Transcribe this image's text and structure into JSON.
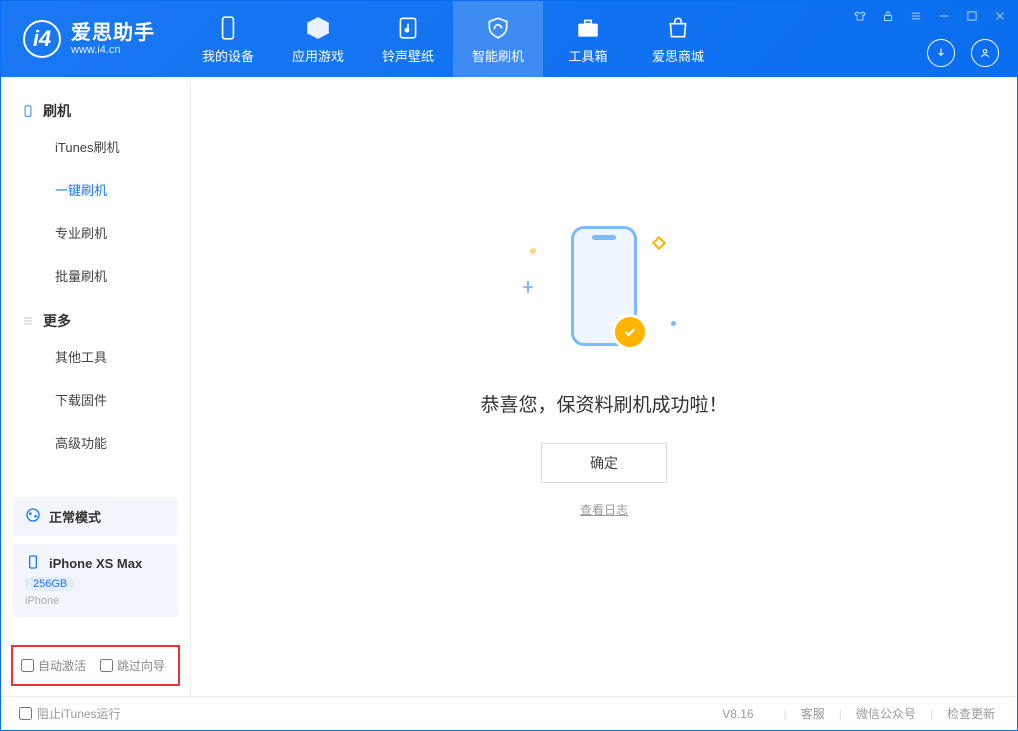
{
  "app": {
    "title": "爱思助手",
    "subtitle": "www.i4.cn"
  },
  "nav": {
    "items": [
      {
        "label": "我的设备"
      },
      {
        "label": "应用游戏"
      },
      {
        "label": "铃声壁纸"
      },
      {
        "label": "智能刷机"
      },
      {
        "label": "工具箱"
      },
      {
        "label": "爱思商城"
      }
    ]
  },
  "sidebar": {
    "group_flash": "刷机",
    "items_flash": [
      {
        "label": "iTunes刷机"
      },
      {
        "label": "一键刷机"
      },
      {
        "label": "专业刷机"
      },
      {
        "label": "批量刷机"
      }
    ],
    "group_more": "更多",
    "items_more": [
      {
        "label": "其他工具"
      },
      {
        "label": "下载固件"
      },
      {
        "label": "高级功能"
      }
    ]
  },
  "device": {
    "mode_label": "正常模式",
    "name": "iPhone XS Max",
    "capacity": "256GB",
    "type": "iPhone"
  },
  "options": {
    "auto_activate": "自动激活",
    "skip_guide": "跳过向导"
  },
  "main": {
    "success_text": "恭喜您，保资料刷机成功啦！",
    "ok_button": "确定",
    "view_log": "查看日志"
  },
  "footer": {
    "block_itunes": "阻止iTunes运行",
    "version": "V8.16",
    "links": [
      "客服",
      "微信公众号",
      "检查更新"
    ]
  }
}
